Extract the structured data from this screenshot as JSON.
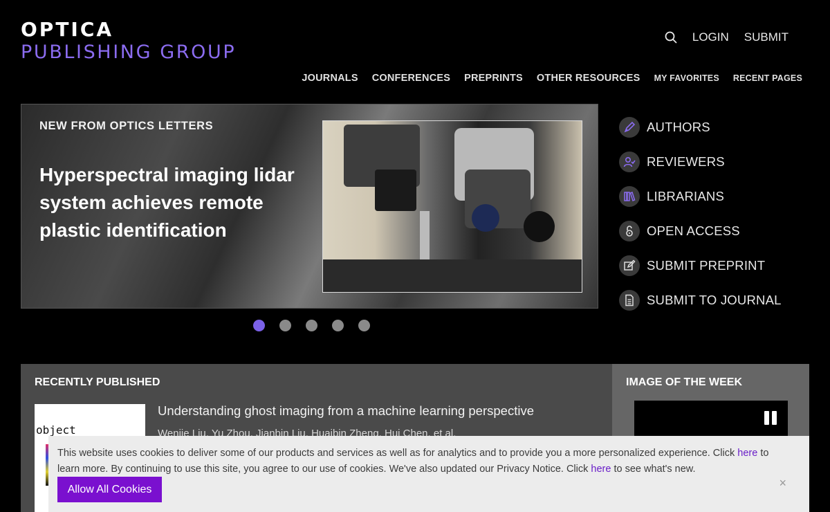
{
  "logo": {
    "line1": "OPTICA",
    "line2": "PUBLISHING GROUP"
  },
  "top_links": {
    "login": "LOGIN",
    "submit": "SUBMIT"
  },
  "main_nav": [
    "JOURNALS",
    "CONFERENCES",
    "PREPRINTS",
    "OTHER RESOURCES",
    "MY FAVORITES",
    "RECENT PAGES"
  ],
  "hero": {
    "eyebrow": "NEW FROM OPTICS LETTERS",
    "title": "Hyperspectral imaging lidar system achieves remote plastic identification",
    "slide_count": 5,
    "active_slide": 1
  },
  "quick_links": [
    {
      "label": "AUTHORS",
      "icon": "pen-icon"
    },
    {
      "label": "REVIEWERS",
      "icon": "user-check-icon"
    },
    {
      "label": "LIBRARIANS",
      "icon": "books-icon"
    },
    {
      "label": "OPEN ACCESS",
      "icon": "open-lock-icon"
    },
    {
      "label": "SUBMIT PREPRINT",
      "icon": "edit-icon"
    },
    {
      "label": "SUBMIT TO JOURNAL",
      "icon": "document-icon"
    }
  ],
  "recent": {
    "heading": "RECENTLY PUBLISHED",
    "thumb_text": "object",
    "article_title": "Understanding ghost imaging from a machine learning perspective",
    "authors": "Wenjie Liu, Yu Zhou, Jianbin Liu, Huaibin Zheng, Hui Chen, et al."
  },
  "image_of_week": {
    "heading": "IMAGE OF THE WEEK"
  },
  "cookie": {
    "text_1": "This website uses cookies to deliver some of our products and services as well as for analytics and to provide you a more personalized experience. Click ",
    "link_1": "here",
    "text_2": " to learn more. By continuing to use this site, you agree to our use of cookies. We've also updated our Privacy Notice. Click ",
    "link_2": "here",
    "text_3": " to see what's new.",
    "button": "Allow All Cookies",
    "close": "×"
  },
  "colors": {
    "brand_purple": "#8b6cf0",
    "button_purple": "#7a10cf",
    "active_dot": "#7b61e8"
  }
}
